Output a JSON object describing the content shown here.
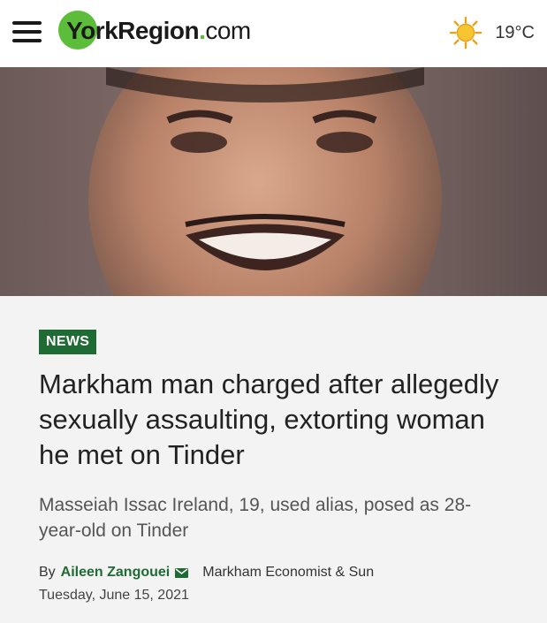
{
  "header": {
    "logo": {
      "york": "York",
      "region": "Region",
      "dot": ".",
      "com": "com"
    },
    "weather": {
      "temp": "19°C",
      "icon": "sun-icon"
    }
  },
  "hero": {
    "image_description": "photo of man smiling"
  },
  "article": {
    "category": "NEWS",
    "headline": "Markham man charged after allegedly sexually assaulting, extorting woman he met on Tinder",
    "subhead": "Masseiah Issac Ireland, 19, used alias, posed as 28-year-old on Tinder",
    "byline": {
      "by": "By",
      "author": "Aileen Zangouei",
      "publication": "Markham Economist & Sun"
    },
    "date": "Tuesday, June 15, 2021"
  },
  "colors": {
    "brand_green": "#5bbd3a",
    "tag_green": "#1f6b34"
  }
}
